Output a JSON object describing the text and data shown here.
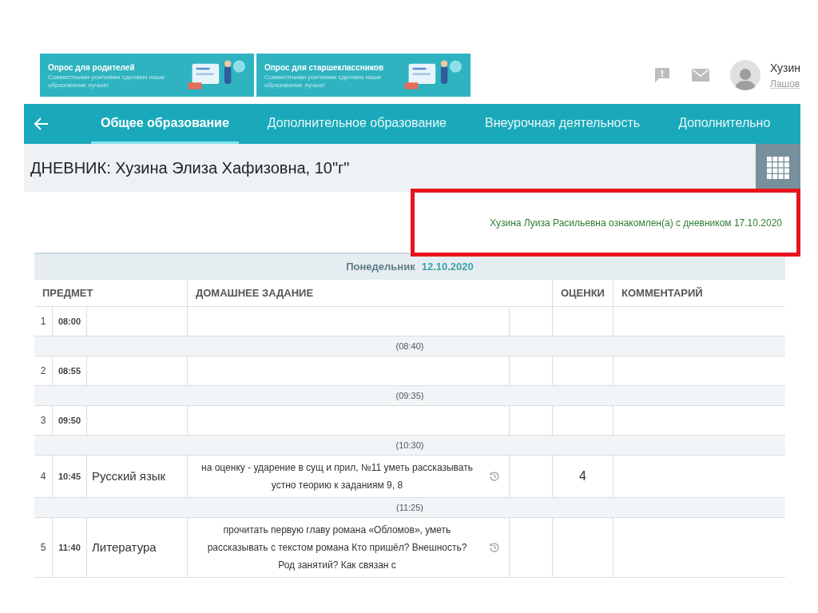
{
  "banners": [
    {
      "title": "Опрос для родителей",
      "subtitle": "Совместными усилиями сделаем наше образование лучше!"
    },
    {
      "title": "Опрос для старшеклассников",
      "subtitle": "Совместными усилиями сделаем наше образование лучше!"
    }
  ],
  "user": {
    "name": "Хузин",
    "school": "Лашов"
  },
  "nav": {
    "tabs": [
      {
        "label": "Общее образование",
        "selected": true
      },
      {
        "label": "Дополнительное образование",
        "selected": false
      },
      {
        "label": "Внеурочная деятельность",
        "selected": false
      },
      {
        "label": "Дополнительно",
        "selected": false
      }
    ]
  },
  "page_title": "ДНЕВНИК: Хузина Элиза Хафизовна, 10\"г\"",
  "notice": {
    "text": "Хузина Луиза Расильевна ознакомлен(а) с дневником 17.10.2020",
    "highlighted": true
  },
  "table": {
    "day": "Понедельник",
    "date": "12.10.2020",
    "columns": [
      "ПРЕДМЕТ",
      "ДОМАШНЕЕ ЗАДАНИЕ",
      "ОЦЕНКИ",
      "КОММЕНТАРИЙ"
    ],
    "rows": [
      {
        "kind": "lesson",
        "number": "1",
        "time": "08:00"
      },
      {
        "kind": "break",
        "time": "(08:40)"
      },
      {
        "kind": "lesson",
        "number": "2",
        "time": "08:55"
      },
      {
        "kind": "break",
        "time": "(09:35)"
      },
      {
        "kind": "lesson",
        "number": "3",
        "time": "09:50"
      },
      {
        "kind": "break",
        "time": "(10:30)"
      },
      {
        "kind": "lesson",
        "number": "4",
        "time": "10:45",
        "subject": "Русский язык",
        "homework": "на оценку - ударение в сущ и прил, №11 уметь рассказывать устно теорию к заданиям 9, 8",
        "grade": "4"
      },
      {
        "kind": "break",
        "time": "(11:25)"
      },
      {
        "kind": "lesson",
        "number": "5",
        "time": "11:40",
        "subject": "Литература",
        "homework": "прочитать первую главу романа «Обломов», уметь рассказывать с текстом романа   Кто пришёл? Внешность? Род занятий? Как связан с"
      }
    ]
  }
}
